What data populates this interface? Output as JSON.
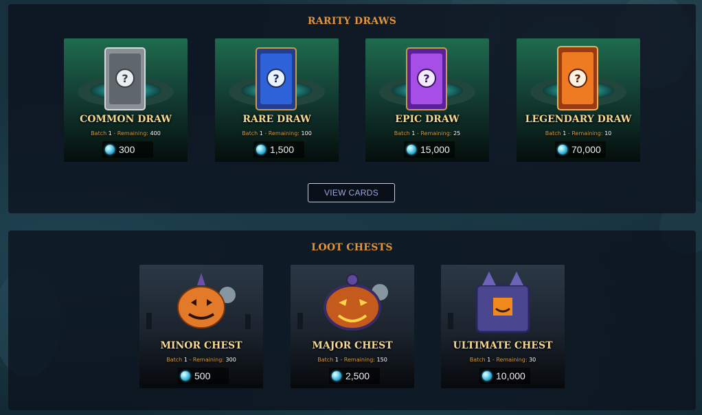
{
  "rarity_draws": {
    "title": "RARITY DRAWS",
    "cards": [
      {
        "name": "COMMON DRAW",
        "batch_label": "Batch",
        "batch_num": "1",
        "remaining_label": "- Remaining:",
        "remaining": "400",
        "price": "300",
        "color": "#9aa0a6"
      },
      {
        "name": "RARE DRAW",
        "batch_label": "Batch",
        "batch_num": "1",
        "remaining_label": "- Remaining:",
        "remaining": "100",
        "price": "1,500",
        "color": "#2f5fd0"
      },
      {
        "name": "EPIC DRAW",
        "batch_label": "Batch",
        "batch_num": "1",
        "remaining_label": "- Remaining:",
        "remaining": "25",
        "price": "15,000",
        "color": "#8b3fd6"
      },
      {
        "name": "LEGENDARY DRAW",
        "batch_label": "Batch",
        "batch_num": "1",
        "remaining_label": "- Remaining:",
        "remaining": "10",
        "price": "70,000",
        "color": "#e0691c"
      }
    ],
    "view_cards_label": "VIEW CARDS"
  },
  "loot_chests": {
    "title": "LOOT CHESTS",
    "chests": [
      {
        "name": "MINOR CHEST",
        "batch_label": "Batch",
        "batch_num": "1",
        "remaining_label": "- Remaining:",
        "remaining": "300",
        "price": "500"
      },
      {
        "name": "MAJOR CHEST",
        "batch_label": "Batch",
        "batch_num": "1",
        "remaining_label": "- Remaining:",
        "remaining": "150",
        "price": "2,500"
      },
      {
        "name": "ULTIMATE CHEST",
        "batch_label": "Batch",
        "batch_num": "1",
        "remaining_label": "- Remaining:",
        "remaining": "30",
        "price": "10,000"
      }
    ]
  },
  "currency_icon": "gem-icon",
  "accent_color": "#e0953b"
}
